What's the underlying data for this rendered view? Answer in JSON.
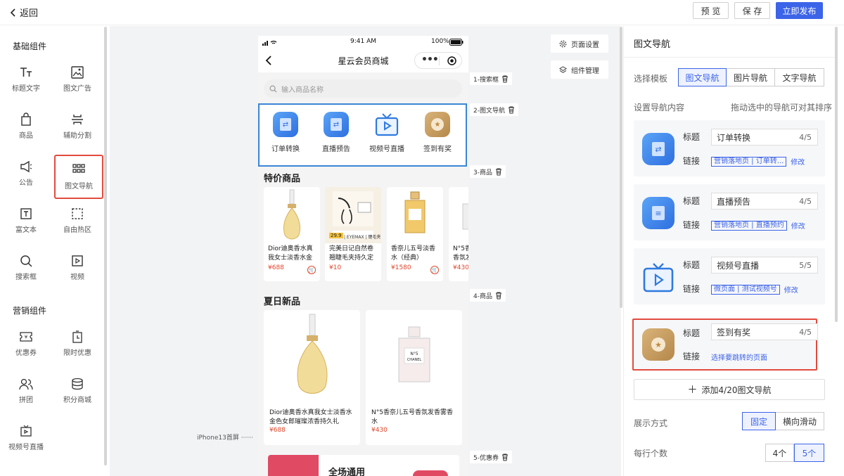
{
  "topbar": {
    "back": "返回",
    "preview": "预 览",
    "save": "保 存",
    "publish": "立即发布"
  },
  "left": {
    "basic_title": "基础组件",
    "basic": [
      {
        "label": "标题文字",
        "icon": "text-icon"
      },
      {
        "label": "图文广告",
        "icon": "image-ad-icon"
      },
      {
        "label": "商品",
        "icon": "bag-icon"
      },
      {
        "label": "辅助分割",
        "icon": "divider-icon"
      },
      {
        "label": "公告",
        "icon": "megaphone-icon"
      },
      {
        "label": "图文导航",
        "icon": "grid-icon"
      },
      {
        "label": "富文本",
        "icon": "rich-text-icon"
      },
      {
        "label": "自由热区",
        "icon": "hotzone-icon"
      },
      {
        "label": "搜索框",
        "icon": "search-icon"
      },
      {
        "label": "视频",
        "icon": "video-icon"
      }
    ],
    "marketing_title": "营销组件",
    "marketing": [
      {
        "label": "优惠券",
        "icon": "coupon-icon"
      },
      {
        "label": "限时优惠",
        "icon": "timer-icon"
      },
      {
        "label": "拼团",
        "icon": "group-icon"
      },
      {
        "label": "积分商城",
        "icon": "coins-icon"
      },
      {
        "label": "视频号直播",
        "icon": "live-tv-icon"
      }
    ]
  },
  "phone": {
    "time": "9:41 AM",
    "battery": "100%",
    "title": "星云会员商城",
    "search_placeholder": "输入商品名称",
    "nav_items": [
      "订单转换",
      "直播预告",
      "视频号直播",
      "签到有奖"
    ],
    "sale_title": "特价商品",
    "sale_products": [
      {
        "name": "Dior迪奥香水真我女士淡香水金",
        "price": "¥688"
      },
      {
        "name": "完美日记自然卷翘睫毛夹持久定",
        "price": "¥10",
        "badge": "29.9",
        "brand": "| EYEMAX | 睫毛夹"
      },
      {
        "name": "香奈儿五号淡香水（经典）",
        "price": "¥1580"
      },
      {
        "name": "N°5香香氛发",
        "price": "¥430"
      }
    ],
    "summer_title": "夏日新品",
    "summer_products": [
      {
        "name": "Dior迪奥香水真我女士淡香水金色女郎璀璨浓香持久礼",
        "price": "¥688"
      },
      {
        "name": "N°5香奈儿五号香氛发香雾香水",
        "price": "¥430"
      }
    ],
    "coupon_text": "全场通用"
  },
  "canvas": {
    "labels": [
      "1-搜索框",
      "2-图文导航",
      "3-商品",
      "4-商品",
      "5-优惠券"
    ],
    "page_settings": "页面设置",
    "component_mgmt": "组件管理",
    "device": "iPhone13首屏 ······"
  },
  "right": {
    "title": "图文导航",
    "template_label": "选择模板",
    "templates": [
      "图文导航",
      "图片导航",
      "文字导航"
    ],
    "content_label": "设置导航内容",
    "drag_hint": "拖动选中的导航可对其排序",
    "title_key": "标题",
    "link_key": "链接",
    "items": [
      {
        "title": "订单转换",
        "count": "4/5",
        "link_tag": "营销落地页 | 订单转...",
        "edit": "修改"
      },
      {
        "title": "直播预告",
        "count": "4/5",
        "link_tag": "营销落地页 | 直播预约",
        "edit": "修改"
      },
      {
        "title": "视频号直播",
        "count": "5/5",
        "link_tag": "微页面 | 测试视频号",
        "edit": "修改"
      },
      {
        "title": "签到有奖",
        "count": "4/5",
        "link_plain": "选择要跳转的页面"
      }
    ],
    "add": "添加4/20图文导航",
    "display_label": "展示方式",
    "display_opts": [
      "固定",
      "横向滑动"
    ],
    "per_row_label": "每行个数",
    "per_row_opts": [
      "4个",
      "5个"
    ]
  },
  "colors": {
    "accent": "#3c64e8",
    "highlight": "#e24b3e",
    "price": "#e2462b"
  }
}
